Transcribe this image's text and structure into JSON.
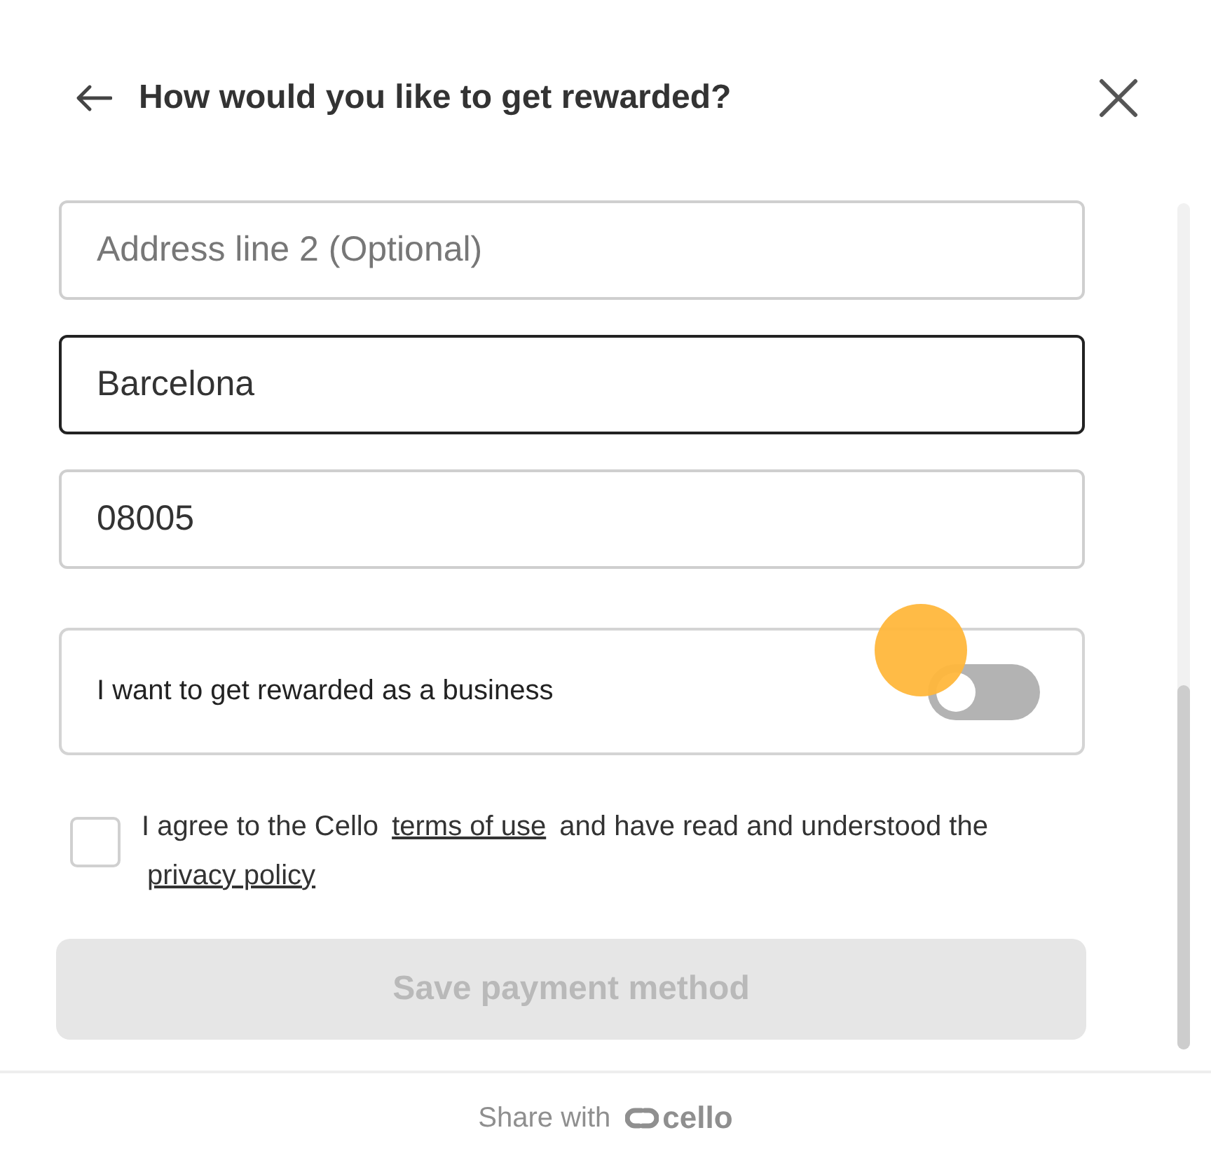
{
  "header": {
    "title": "How would you like to get rewarded?"
  },
  "fields": [
    {
      "placeholder": "Address line 2 (Optional)",
      "focused": false
    },
    {
      "value": "Barcelona",
      "focused": true
    },
    {
      "value": "08005",
      "focused": false
    }
  ],
  "business_toggle": {
    "label": "I want to get rewarded as a business",
    "on": false
  },
  "terms": {
    "checked": false,
    "text_before": "I agree to the Cello",
    "link_1": "terms of use",
    "text_middle": "and have read and understood the",
    "link_2": "privacy policy"
  },
  "save_button": {
    "label": "Save payment method",
    "disabled": true
  },
  "footer": {
    "text": "Share with",
    "brand": "cello"
  }
}
